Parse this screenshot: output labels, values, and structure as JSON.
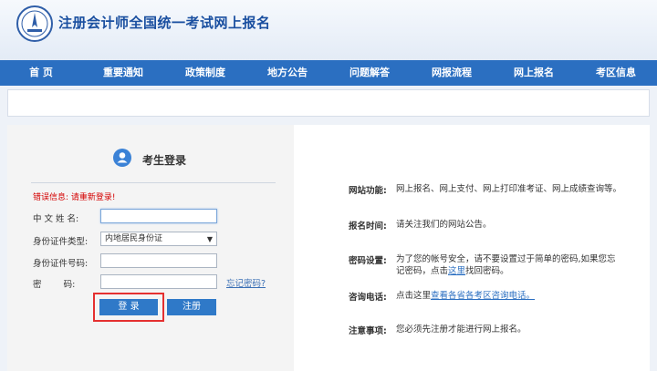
{
  "header": {
    "site_title": "注册会计师全国统一考试网上报名",
    "logo_icon": "exam-emblem-icon"
  },
  "nav": {
    "items": [
      "首 页",
      "重要通知",
      "政策制度",
      "地方公告",
      "问题解答",
      "网报流程",
      "网上报名",
      "考区信息"
    ]
  },
  "login": {
    "title": "考生登录",
    "error": "错误信息: 请重新登录!",
    "name_label": "中 文 姓 名:",
    "name_value": "",
    "id_type_label": "身份证件类型:",
    "id_type_value": "内地居民身份证",
    "id_number_label": "身份证件号码:",
    "id_number_value": "",
    "password_label": "密        码:",
    "password_value": "",
    "forgot_link": "忘记密码?",
    "login_button": "登 录",
    "register_button": "注册"
  },
  "info": {
    "rows": [
      {
        "key": "网站功能:",
        "value": "网上报名、网上支付、网上打印准考证、网上成绩查询等。"
      },
      {
        "key": "报名时间:",
        "value": "请关注我们的网站公告。"
      },
      {
        "key": "密码设置:",
        "value_pre": "为了您的帐号安全，请不要设置过于简单的密码,如果您忘记密码，点击",
        "value_link": "这里",
        "value_post": "找回密码。"
      },
      {
        "key": "咨询电话:",
        "value_pre": "点击这里",
        "value_link": "查看各省各考区咨询电话。",
        "value_post": ""
      },
      {
        "key": "注意事项:",
        "value": "您必须先注册才能进行网上报名。"
      }
    ]
  },
  "colors": {
    "nav": "#2b6fc1",
    "title": "#1a4fa0",
    "error": "#d40000",
    "highlight": "#e53030"
  }
}
